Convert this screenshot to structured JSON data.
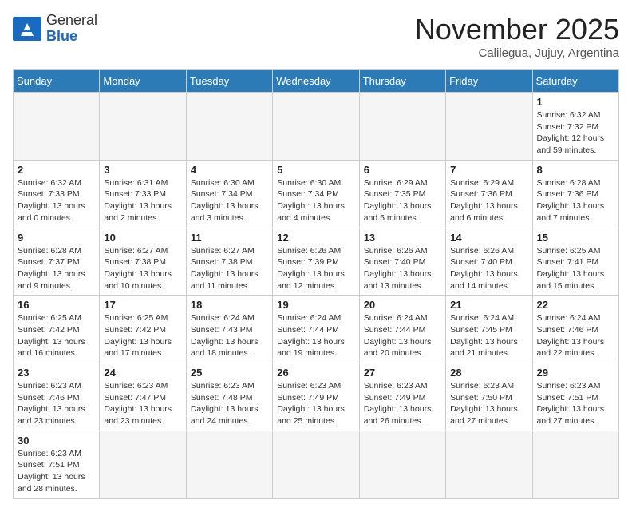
{
  "logo": {
    "general": "General",
    "blue": "Blue"
  },
  "header": {
    "month": "November 2025",
    "location": "Calilegua, Jujuy, Argentina"
  },
  "days_of_week": [
    "Sunday",
    "Monday",
    "Tuesday",
    "Wednesday",
    "Thursday",
    "Friday",
    "Saturday"
  ],
  "weeks": [
    [
      {
        "day": "",
        "info": ""
      },
      {
        "day": "",
        "info": ""
      },
      {
        "day": "",
        "info": ""
      },
      {
        "day": "",
        "info": ""
      },
      {
        "day": "",
        "info": ""
      },
      {
        "day": "",
        "info": ""
      },
      {
        "day": "1",
        "info": "Sunrise: 6:32 AM\nSunset: 7:32 PM\nDaylight: 12 hours and 59 minutes."
      }
    ],
    [
      {
        "day": "2",
        "info": "Sunrise: 6:32 AM\nSunset: 7:33 PM\nDaylight: 13 hours and 0 minutes."
      },
      {
        "day": "3",
        "info": "Sunrise: 6:31 AM\nSunset: 7:33 PM\nDaylight: 13 hours and 2 minutes."
      },
      {
        "day": "4",
        "info": "Sunrise: 6:30 AM\nSunset: 7:34 PM\nDaylight: 13 hours and 3 minutes."
      },
      {
        "day": "5",
        "info": "Sunrise: 6:30 AM\nSunset: 7:34 PM\nDaylight: 13 hours and 4 minutes."
      },
      {
        "day": "6",
        "info": "Sunrise: 6:29 AM\nSunset: 7:35 PM\nDaylight: 13 hours and 5 minutes."
      },
      {
        "day": "7",
        "info": "Sunrise: 6:29 AM\nSunset: 7:36 PM\nDaylight: 13 hours and 6 minutes."
      },
      {
        "day": "8",
        "info": "Sunrise: 6:28 AM\nSunset: 7:36 PM\nDaylight: 13 hours and 7 minutes."
      }
    ],
    [
      {
        "day": "9",
        "info": "Sunrise: 6:28 AM\nSunset: 7:37 PM\nDaylight: 13 hours and 9 minutes."
      },
      {
        "day": "10",
        "info": "Sunrise: 6:27 AM\nSunset: 7:38 PM\nDaylight: 13 hours and 10 minutes."
      },
      {
        "day": "11",
        "info": "Sunrise: 6:27 AM\nSunset: 7:38 PM\nDaylight: 13 hours and 11 minutes."
      },
      {
        "day": "12",
        "info": "Sunrise: 6:26 AM\nSunset: 7:39 PM\nDaylight: 13 hours and 12 minutes."
      },
      {
        "day": "13",
        "info": "Sunrise: 6:26 AM\nSunset: 7:40 PM\nDaylight: 13 hours and 13 minutes."
      },
      {
        "day": "14",
        "info": "Sunrise: 6:26 AM\nSunset: 7:40 PM\nDaylight: 13 hours and 14 minutes."
      },
      {
        "day": "15",
        "info": "Sunrise: 6:25 AM\nSunset: 7:41 PM\nDaylight: 13 hours and 15 minutes."
      }
    ],
    [
      {
        "day": "16",
        "info": "Sunrise: 6:25 AM\nSunset: 7:42 PM\nDaylight: 13 hours and 16 minutes."
      },
      {
        "day": "17",
        "info": "Sunrise: 6:25 AM\nSunset: 7:42 PM\nDaylight: 13 hours and 17 minutes."
      },
      {
        "day": "18",
        "info": "Sunrise: 6:24 AM\nSunset: 7:43 PM\nDaylight: 13 hours and 18 minutes."
      },
      {
        "day": "19",
        "info": "Sunrise: 6:24 AM\nSunset: 7:44 PM\nDaylight: 13 hours and 19 minutes."
      },
      {
        "day": "20",
        "info": "Sunrise: 6:24 AM\nSunset: 7:44 PM\nDaylight: 13 hours and 20 minutes."
      },
      {
        "day": "21",
        "info": "Sunrise: 6:24 AM\nSunset: 7:45 PM\nDaylight: 13 hours and 21 minutes."
      },
      {
        "day": "22",
        "info": "Sunrise: 6:24 AM\nSunset: 7:46 PM\nDaylight: 13 hours and 22 minutes."
      }
    ],
    [
      {
        "day": "23",
        "info": "Sunrise: 6:23 AM\nSunset: 7:46 PM\nDaylight: 13 hours and 23 minutes."
      },
      {
        "day": "24",
        "info": "Sunrise: 6:23 AM\nSunset: 7:47 PM\nDaylight: 13 hours and 23 minutes."
      },
      {
        "day": "25",
        "info": "Sunrise: 6:23 AM\nSunset: 7:48 PM\nDaylight: 13 hours and 24 minutes."
      },
      {
        "day": "26",
        "info": "Sunrise: 6:23 AM\nSunset: 7:49 PM\nDaylight: 13 hours and 25 minutes."
      },
      {
        "day": "27",
        "info": "Sunrise: 6:23 AM\nSunset: 7:49 PM\nDaylight: 13 hours and 26 minutes."
      },
      {
        "day": "28",
        "info": "Sunrise: 6:23 AM\nSunset: 7:50 PM\nDaylight: 13 hours and 27 minutes."
      },
      {
        "day": "29",
        "info": "Sunrise: 6:23 AM\nSunset: 7:51 PM\nDaylight: 13 hours and 27 minutes."
      }
    ],
    [
      {
        "day": "30",
        "info": "Sunrise: 6:23 AM\nSunset: 7:51 PM\nDaylight: 13 hours and 28 minutes."
      },
      {
        "day": "",
        "info": ""
      },
      {
        "day": "",
        "info": ""
      },
      {
        "day": "",
        "info": ""
      },
      {
        "day": "",
        "info": ""
      },
      {
        "day": "",
        "info": ""
      },
      {
        "day": "",
        "info": ""
      }
    ]
  ]
}
